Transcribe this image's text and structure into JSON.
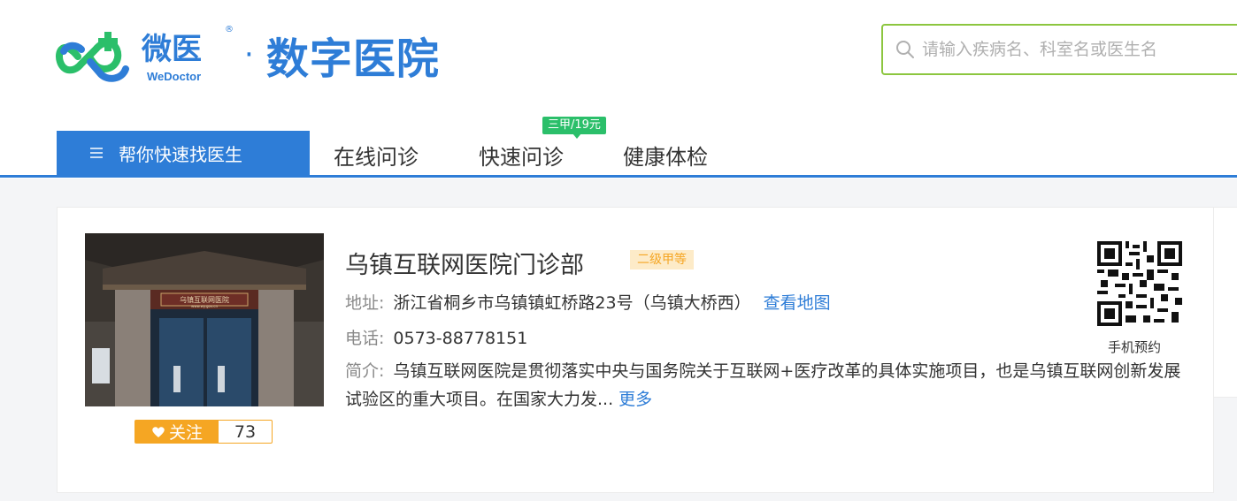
{
  "header": {
    "logo_cn": "微医",
    "logo_en": "WeDoctor",
    "logo_reg": "®",
    "separator": "·",
    "site_title": "数字医院"
  },
  "search": {
    "placeholder": "请输入疾病名、科室名或医生名",
    "border_color": "#8cc63f"
  },
  "nav": {
    "main_label": "帮你快速找医生",
    "items": [
      {
        "label": "在线问诊"
      },
      {
        "label": "快速问诊",
        "badge": "三甲/19元"
      },
      {
        "label": "健康体检"
      }
    ],
    "accent_color": "#2e7dd7"
  },
  "hospital": {
    "name": "乌镇互联网医院门诊部",
    "level": "二级甲等",
    "address_label": "地址:",
    "address": "浙江省桐乡市乌镇镇虹桥路23号（乌镇大桥西）",
    "map_link": "查看地图",
    "phone_label": "电话:",
    "phone": "0573-88778151",
    "intro_label": "简介:",
    "intro": "乌镇互联网医院是贯彻落实中央与国务院关于互联网+医疗改革的具体实施项目，也是乌镇互联网创新发展试验区的重大项目。在国家大力发...",
    "more_link": "更多",
    "follow_label": "关注",
    "follow_icon": "heart-icon",
    "follow_count": "73",
    "mobile_booking_label": "手机预约",
    "photo_sign": "乌镇互联网医院",
    "photo_sign_url": "www.wy.gov.cn"
  }
}
